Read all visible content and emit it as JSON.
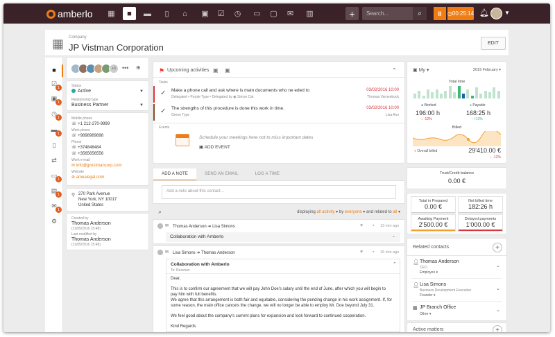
{
  "app": {
    "logo_text": "amberlo"
  },
  "topbar": {
    "search_placeholder": "Search...",
    "timer": "00:25:14",
    "pause_label": "II"
  },
  "company": {
    "label": "Company",
    "name": "JP Vistman Corporation",
    "edit_label": "EDIT"
  },
  "people": {
    "more_count": "+3"
  },
  "status": {
    "label": "Status",
    "value": "Active"
  },
  "relationship": {
    "label": "Relationship type",
    "value": "Business Partner"
  },
  "contact": {
    "mobile_label": "Mobile phone",
    "mobile": "+1 212-270-9999",
    "work_phone_label": "Work phone",
    "work_phone": "+9898989898",
    "phone_label": "Phone",
    "phone1": "+374848484",
    "phone2": "+3565656556",
    "email_label": "Work e-mail",
    "email": "info@jpvistmancorp.com",
    "website_label": "Website",
    "website": "amealegal.com"
  },
  "address": {
    "line1": "270 Park Avenue",
    "line2": "New York, NY 10017",
    "line3": "United States"
  },
  "created": {
    "label": "Created by",
    "name": "Thomas Anderson",
    "date": "(11/05/2016 15:48)"
  },
  "modified": {
    "label": "Last modified by",
    "name": "Thomas Anderson",
    "date": "(11/05/2016 15:48)"
  },
  "upcoming": {
    "title": "Upcoming activities",
    "tasks_label": "Tasks",
    "tasks": [
      {
        "title": "Make a phone call and ask where is main documents who ne eded to",
        "meta": "Delegated • Purple Type • Delegated by",
        "meta_person": "Simon Cat",
        "date": "03/02/2016 10:00",
        "owner": "Thomas Varnenbock"
      },
      {
        "title": "The strengths of this procedure is done this work in time.",
        "meta": "Green Type",
        "meta_person": "",
        "date": "03/02/2016 10:00",
        "owner": "Lisa Ann"
      }
    ],
    "events_label": "Events",
    "events_hint": "Schedule your meetings here not to miss important dates",
    "add_event": "ADD EVENT"
  },
  "tabs": [
    {
      "label": "ADD A NOTE"
    },
    {
      "label": "SEND AN EMAIL"
    },
    {
      "label": "LOG A TIME"
    }
  ],
  "note": {
    "placeholder": "Add a note about this contact..."
  },
  "filter": {
    "displaying": "displaying",
    "all_activity": "all activity",
    "by": "by",
    "everyone": "everyone",
    "related_to": "and related to",
    "all": "all"
  },
  "activity1": {
    "from": "Thomas Anderson",
    "to": "Lisa Simons",
    "time": "13 min ago",
    "subject": "Collaboration with Amberlo"
  },
  "activity2": {
    "from": "Lisa Simons",
    "to": "Thomas Anderson",
    "time": "15 min ago",
    "subject": "Collaboration with Amberlo",
    "card_title": "Collaboration with Amberlo",
    "to_line": "To: Receiver",
    "greeting": "Dear,",
    "p1": "This is to confirm our agreement that we will pay John Doe's salary until the end of June, after which you will begin to pay him with full benefits.",
    "p2": "We agree that this arrangement is both fair and equitable, considering the pending change in his work assignment. If, for some reason, the main office cancels the change, we will no longer be able to employ Mr. Doe beyond July 31.",
    "p3": "We feel good about the company's current plans for expansion and look forward to continued cooperation.",
    "sign": "Kind Regards"
  },
  "stats": {
    "my_label": "My",
    "period": "2019 February",
    "total_time": "Total time",
    "worked_label": "Worked",
    "worked_value": "196:00 h",
    "worked_change": "-12%",
    "payable_label": "Payable",
    "payable_value": "168:25 h",
    "payable_change": "+12%",
    "billed_label": "Billed",
    "overall_label": "Overall billed",
    "overall_value": "29'410.00 €",
    "overall_change": "-12%"
  },
  "trust": {
    "title": "Trust/Credit balance",
    "value": "0.00 €"
  },
  "totals": [
    {
      "title": "Total in Prepared",
      "value": "0.00 €",
      "accent": "#cfcfcf"
    },
    {
      "title": "Not billed time",
      "value": "182:26 h",
      "accent": "#cfcfcf"
    },
    {
      "title": "Awaiting Payment",
      "value": "2'500.00 €",
      "accent": "#f0a030"
    },
    {
      "title": "Delayed payments",
      "value": "1'000.00 €",
      "accent": "#d9363e"
    }
  ],
  "related": {
    "title": "Related contacts",
    "items": [
      {
        "name": "Thomas Anderson",
        "role": "CEO",
        "tag": "Employee"
      },
      {
        "name": "Lisa Simons",
        "role": "Business Development Executive",
        "tag": "Founder"
      },
      {
        "name": "JP Branch Office",
        "role": "",
        "tag": "Other"
      }
    ]
  },
  "matters": {
    "title": "Active matters"
  },
  "chart_data": {
    "type": "bar",
    "title": "Total time",
    "bars": [
      3,
      5,
      2,
      6,
      4,
      6,
      3,
      5,
      8,
      4,
      8,
      3,
      6,
      2,
      7,
      3,
      5,
      4,
      7,
      5
    ],
    "highlights": [
      10,
      11,
      13
    ]
  },
  "colors": {
    "accent": "#f07c14",
    "topbar": "#3a2228",
    "teal": "#2aa6a0",
    "green": "#3cb878",
    "blue": "#1f5fa8"
  }
}
